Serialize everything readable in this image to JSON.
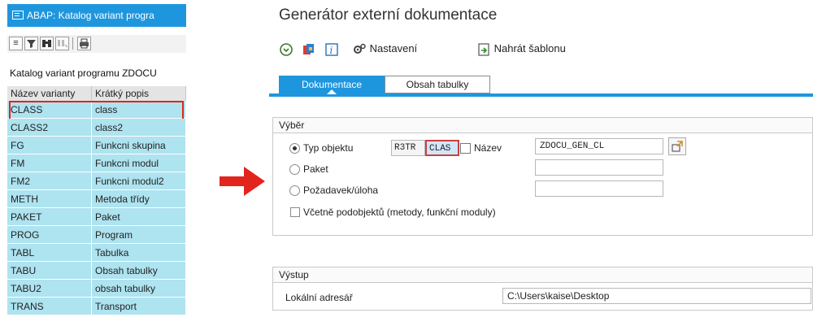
{
  "left": {
    "title": "ABAP: Katalog variant progra",
    "toolbar_icons": [
      "align-left-icon",
      "filter-icon",
      "binoculars-icon",
      "find-next-icon",
      "print-icon"
    ],
    "heading": "Katalog variant programu ZDOCU",
    "columns": [
      "Název varianty",
      "Krátký popis"
    ],
    "rows": [
      {
        "name": "CLASS",
        "desc": "class"
      },
      {
        "name": "CLASS2",
        "desc": "class2"
      },
      {
        "name": "FG",
        "desc": "Funkcni skupina"
      },
      {
        "name": "FM",
        "desc": "Funkcni modul"
      },
      {
        "name": "FM2",
        "desc": "Funkcni modul2"
      },
      {
        "name": "METH",
        "desc": "Metoda třídy"
      },
      {
        "name": "PAKET",
        "desc": "Paket"
      },
      {
        "name": "PROG",
        "desc": "Program"
      },
      {
        "name": "TABL",
        "desc": "Tabulka"
      },
      {
        "name": "TABU",
        "desc": "Obsah tabulky"
      },
      {
        "name": "TABU2",
        "desc": "obsah tabulky"
      },
      {
        "name": "TRANS",
        "desc": "Transport"
      }
    ],
    "selected_row": "CLASS",
    "row_color": "#aee3f0",
    "highlight_color": "#e2241e"
  },
  "arrow_color": "#e2241e",
  "right": {
    "title": "Generátor externí dokumentace",
    "toolbar": {
      "execute_icon": "execute-icon",
      "variant_icon": "variant-icon",
      "info_icon": "info-icon",
      "settings_label": "Nastavení",
      "upload_label": "Nahrát šablonu"
    },
    "tabs": [
      "Dokumentace",
      "Obsah tabulky"
    ],
    "active_tab": "Dokumentace",
    "accent": "#1e96de",
    "selection": {
      "title": "Výběr",
      "object_type_label": "Typ objektu",
      "pgmid": "R3TR",
      "object": "CLAS",
      "name_label": "Název",
      "name_value": "ZDOCU_GEN_CL",
      "package_label": "Paket",
      "package_value": "",
      "request_label": "Požadavek/úloha",
      "request_value": "",
      "subobjects_label": "Včetně podobjektů (metody, funkční moduly)"
    },
    "output": {
      "title": "Výstup",
      "local_dir_label": "Lokální adresář",
      "local_dir_value": "C:\\Users\\kaise\\Desktop"
    }
  }
}
